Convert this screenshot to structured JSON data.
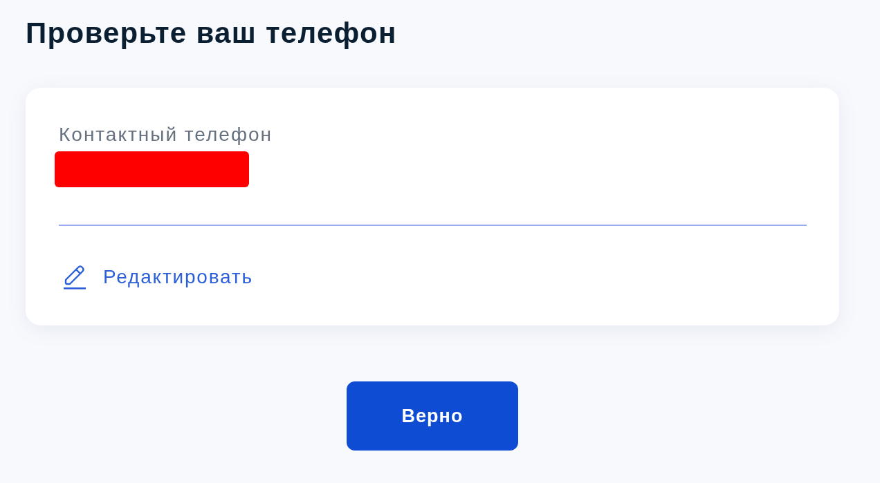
{
  "page": {
    "title": "Проверьте ваш телефон"
  },
  "card": {
    "field": {
      "label": "Контактный телефон",
      "redacted": true
    },
    "edit_link": {
      "label": "Редактировать"
    }
  },
  "confirm_button": {
    "label": "Верно"
  }
}
